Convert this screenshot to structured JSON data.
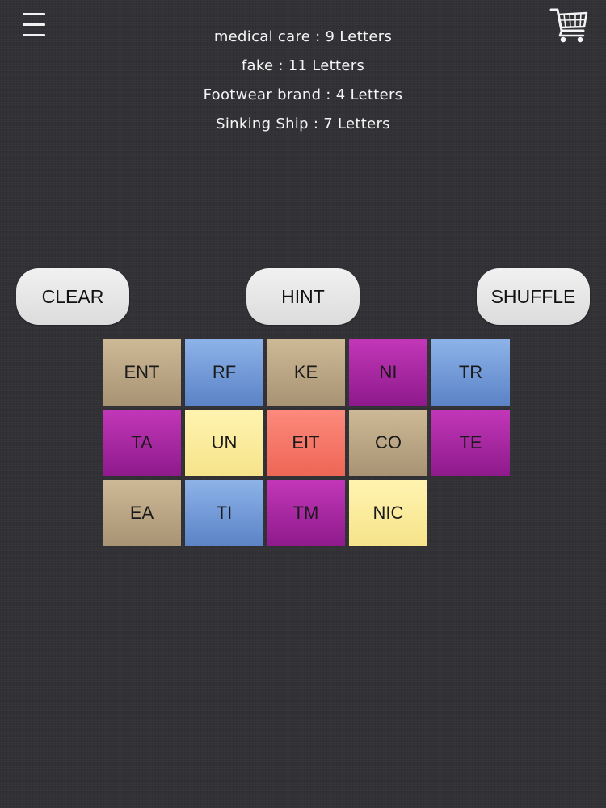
{
  "clues": [
    "medical care : 9 Letters",
    "fake : 11 Letters",
    "Footwear brand : 4 Letters",
    "Sinking Ship : 7 Letters"
  ],
  "buttons": {
    "clear": "CLEAR",
    "hint": "HINT",
    "shuffle": "SHUFFLE"
  },
  "icons": {
    "menu": "menu-icon",
    "cart": "shopping-cart-icon"
  },
  "tiles": [
    {
      "text": "ENT",
      "color": "tan"
    },
    {
      "text": "RF",
      "color": "blue"
    },
    {
      "text": "KE",
      "color": "tan"
    },
    {
      "text": "NI",
      "color": "purple"
    },
    {
      "text": "TR",
      "color": "blue"
    },
    {
      "text": "TA",
      "color": "purple"
    },
    {
      "text": "UN",
      "color": "yellow"
    },
    {
      "text": "EIT",
      "color": "salmon"
    },
    {
      "text": "CO",
      "color": "tan"
    },
    {
      "text": "TE",
      "color": "purple"
    },
    {
      "text": "EA",
      "color": "tan"
    },
    {
      "text": "TI",
      "color": "blue"
    },
    {
      "text": "TM",
      "color": "purple"
    },
    {
      "text": "NIC",
      "color": "yellow"
    }
  ],
  "colors": {
    "tan": [
      "#cdb995",
      "#a89474"
    ],
    "blue": [
      "#8db3e9",
      "#5b83c6"
    ],
    "purple": [
      "#c237b8",
      "#8e1a8c"
    ],
    "yellow": [
      "#fff3b0",
      "#f6e48a"
    ],
    "salmon": [
      "#fc8a7c",
      "#ee6656"
    ]
  }
}
